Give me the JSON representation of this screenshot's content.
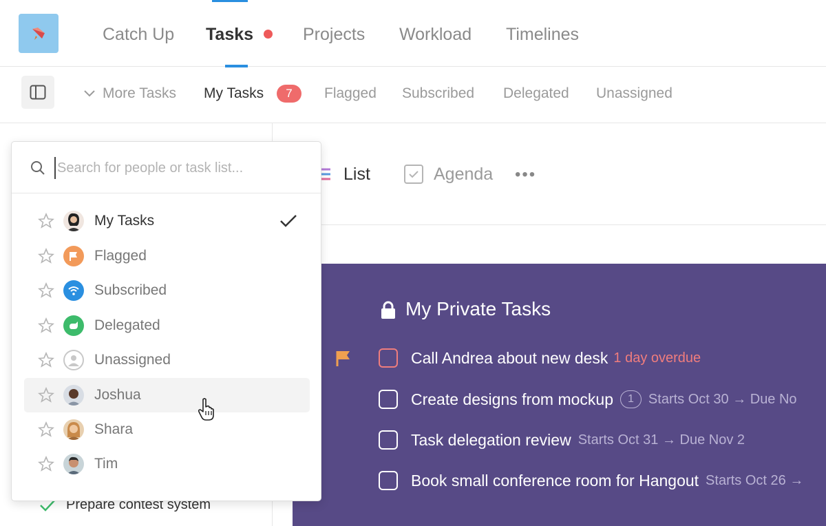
{
  "top_nav": {
    "tabs": [
      "Catch Up",
      "Tasks",
      "Projects",
      "Workload",
      "Timelines"
    ],
    "active": "Tasks"
  },
  "sub_nav": {
    "more_tasks": "More Tasks",
    "tabs": [
      "My Tasks",
      "Flagged",
      "Subscribed",
      "Delegated",
      "Unassigned"
    ],
    "active": "My Tasks",
    "badge": "7"
  },
  "views": {
    "list": "List",
    "agenda": "Agenda"
  },
  "dropdown": {
    "search_placeholder": "Search for people or task list...",
    "items": [
      {
        "label": "My Tasks",
        "selected": true
      },
      {
        "label": "Flagged"
      },
      {
        "label": "Subscribed"
      },
      {
        "label": "Delegated"
      },
      {
        "label": "Unassigned"
      },
      {
        "label": "Joshua"
      },
      {
        "label": "Shara"
      },
      {
        "label": "Tim"
      }
    ]
  },
  "panel": {
    "title": "My Private Tasks",
    "tasks": [
      {
        "title": "Call Andrea about new desk",
        "overdue": "1 day overdue"
      },
      {
        "title": "Create designs from mockup",
        "comments": "1",
        "meta": "Starts Oct 30 → Due No"
      },
      {
        "title": "Task delegation review",
        "meta": "Starts Oct 31 → Due Nov 2"
      },
      {
        "title": "Book small conference room for Hangout",
        "meta": "Starts Oct 26 →"
      }
    ]
  },
  "background_list": {
    "item": "Prepare contest system"
  },
  "colors": {
    "accent": "#2a8fe0",
    "badge": "#ef6b6b",
    "panel": "#574a86",
    "overdue": "#f07d7d"
  }
}
